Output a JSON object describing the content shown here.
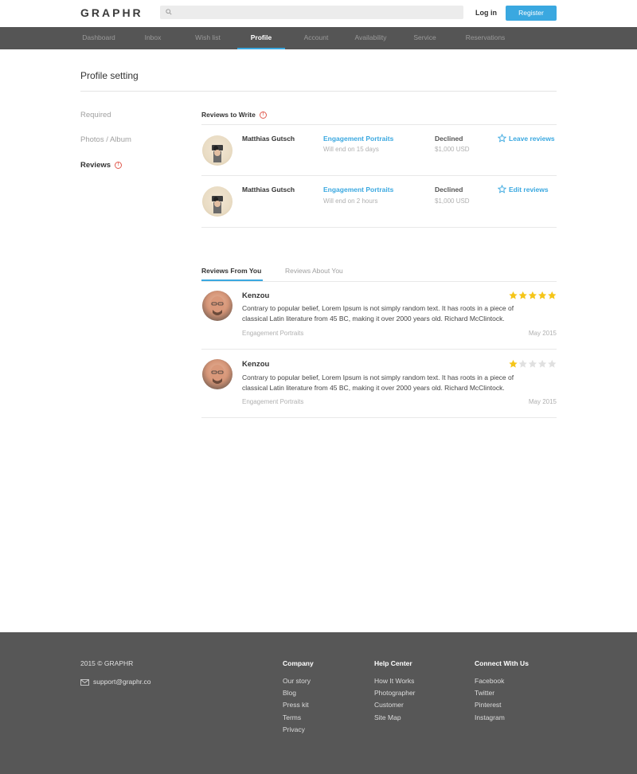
{
  "header": {
    "logo": "GRAPHR",
    "search": {
      "placeholder": "",
      "value": ""
    },
    "login_label": "Log in",
    "register_label": "Register"
  },
  "nav": {
    "items": [
      "Dashboard",
      "Inbox",
      "Wish list",
      "Profile",
      "Account",
      "Availability",
      "Service",
      "Reservations"
    ],
    "active": "Profile"
  },
  "page": {
    "title": "Profile setting",
    "sidebar": {
      "items": [
        "Required",
        "Photos / Album",
        "Reviews"
      ],
      "active": "Reviews"
    }
  },
  "reviews_to_write": {
    "heading": "Reviews to Write",
    "rows": [
      {
        "name": "Matthias Gutsch",
        "service": "Engagement Portraits",
        "ends": "Will end on 15 days",
        "status": "Declined",
        "price": "$1,000 USD",
        "action": "Leave reviews"
      },
      {
        "name": "Matthias Gutsch",
        "service": "Engagement Portraits",
        "ends": "Will end on 2 hours",
        "status": "Declined",
        "price": "$1,000 USD",
        "action": "Edit reviews"
      }
    ]
  },
  "review_tabs": {
    "tabs": [
      "Reviews From You",
      "Reviews About You"
    ],
    "active": "Reviews From You"
  },
  "reviews_from_you": [
    {
      "name": "Kenzou",
      "rating": 5,
      "max_rating": 5,
      "text_line1": "Contrary to popular belief, Lorem Ipsum is not simply random text. It has roots in a piece of",
      "text_line2": "classical Latin literature from 45 BC, making it over 2000 years old. Richard McClintock.",
      "category": "Engagement Portraits",
      "date": "May 2015"
    },
    {
      "name": "Kenzou",
      "rating": 1,
      "max_rating": 5,
      "text_line1": "Contrary to popular belief, Lorem Ipsum is not simply random text. It has roots in a piece of",
      "text_line2": "classical Latin literature from 45 BC, making it over 2000 years old. Richard McClintock.",
      "category": "Engagement Portraits",
      "date": "May 2015"
    }
  ],
  "colors": {
    "accent": "#3aa8e0",
    "nav_bg": "#555555",
    "footer_bg": "#575757",
    "star_on": "#f5c518",
    "star_off": "#e0e0e0",
    "warning": "#e05a4f"
  },
  "footer": {
    "copyright": "2015 © GRAPHR",
    "support_email": "support@graphr.co",
    "columns": [
      {
        "heading": "Company",
        "links": [
          "Our story",
          "Blog",
          "Press kit",
          "Terms",
          "Privacy"
        ]
      },
      {
        "heading": "Help Center",
        "links": [
          "How It Works",
          "Photographer",
          "Customer",
          "Site Map"
        ]
      },
      {
        "heading": "Connect With Us",
        "links": [
          "Facebook",
          "Twitter",
          "Pinterest",
          "Instagram"
        ]
      }
    ]
  }
}
